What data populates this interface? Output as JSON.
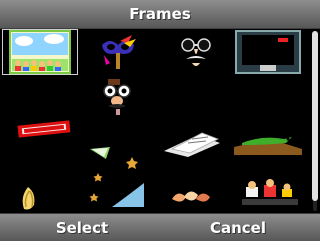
{
  "title": "Frames",
  "softkeys": {
    "left": "Select",
    "right": "Cancel"
  },
  "frames": [
    {
      "icon": "sky-children-frame-icon",
      "selected": true
    },
    {
      "icon": "carnival-mask-frame-icon",
      "selected": false
    },
    {
      "icon": "glasses-mustache-frame-icon",
      "selected": false
    },
    {
      "icon": "tv-screen-frame-icon",
      "selected": false
    },
    {
      "icon": "empty-slot",
      "selected": false
    },
    {
      "icon": "funny-face-frame-icon",
      "selected": false
    },
    {
      "icon": "empty-slot",
      "selected": false
    },
    {
      "icon": "empty-slot",
      "selected": false
    },
    {
      "icon": "stamp-text-frame-icon",
      "selected": false
    },
    {
      "icon": "empty-slot",
      "selected": false
    },
    {
      "icon": "paper-stack-frame-icon",
      "selected": false
    },
    {
      "icon": "lizard-frame-icon",
      "selected": false
    },
    {
      "icon": "empty-slot",
      "selected": false
    },
    {
      "icon": "envelope-stars-frame-icon",
      "selected": false
    },
    {
      "icon": "empty-slot",
      "selected": false
    },
    {
      "icon": "empty-slot",
      "selected": false
    },
    {
      "icon": "yellow-flower-frame-icon",
      "selected": false
    },
    {
      "icon": "blue-wave-frame-icon",
      "selected": false
    },
    {
      "icon": "seashells-frame-icon",
      "selected": false
    },
    {
      "icon": "party-characters-frame-icon",
      "selected": false
    }
  ],
  "colors": {
    "bar": "#6f6f6f",
    "background": "#000000",
    "text": "#ffffff"
  }
}
